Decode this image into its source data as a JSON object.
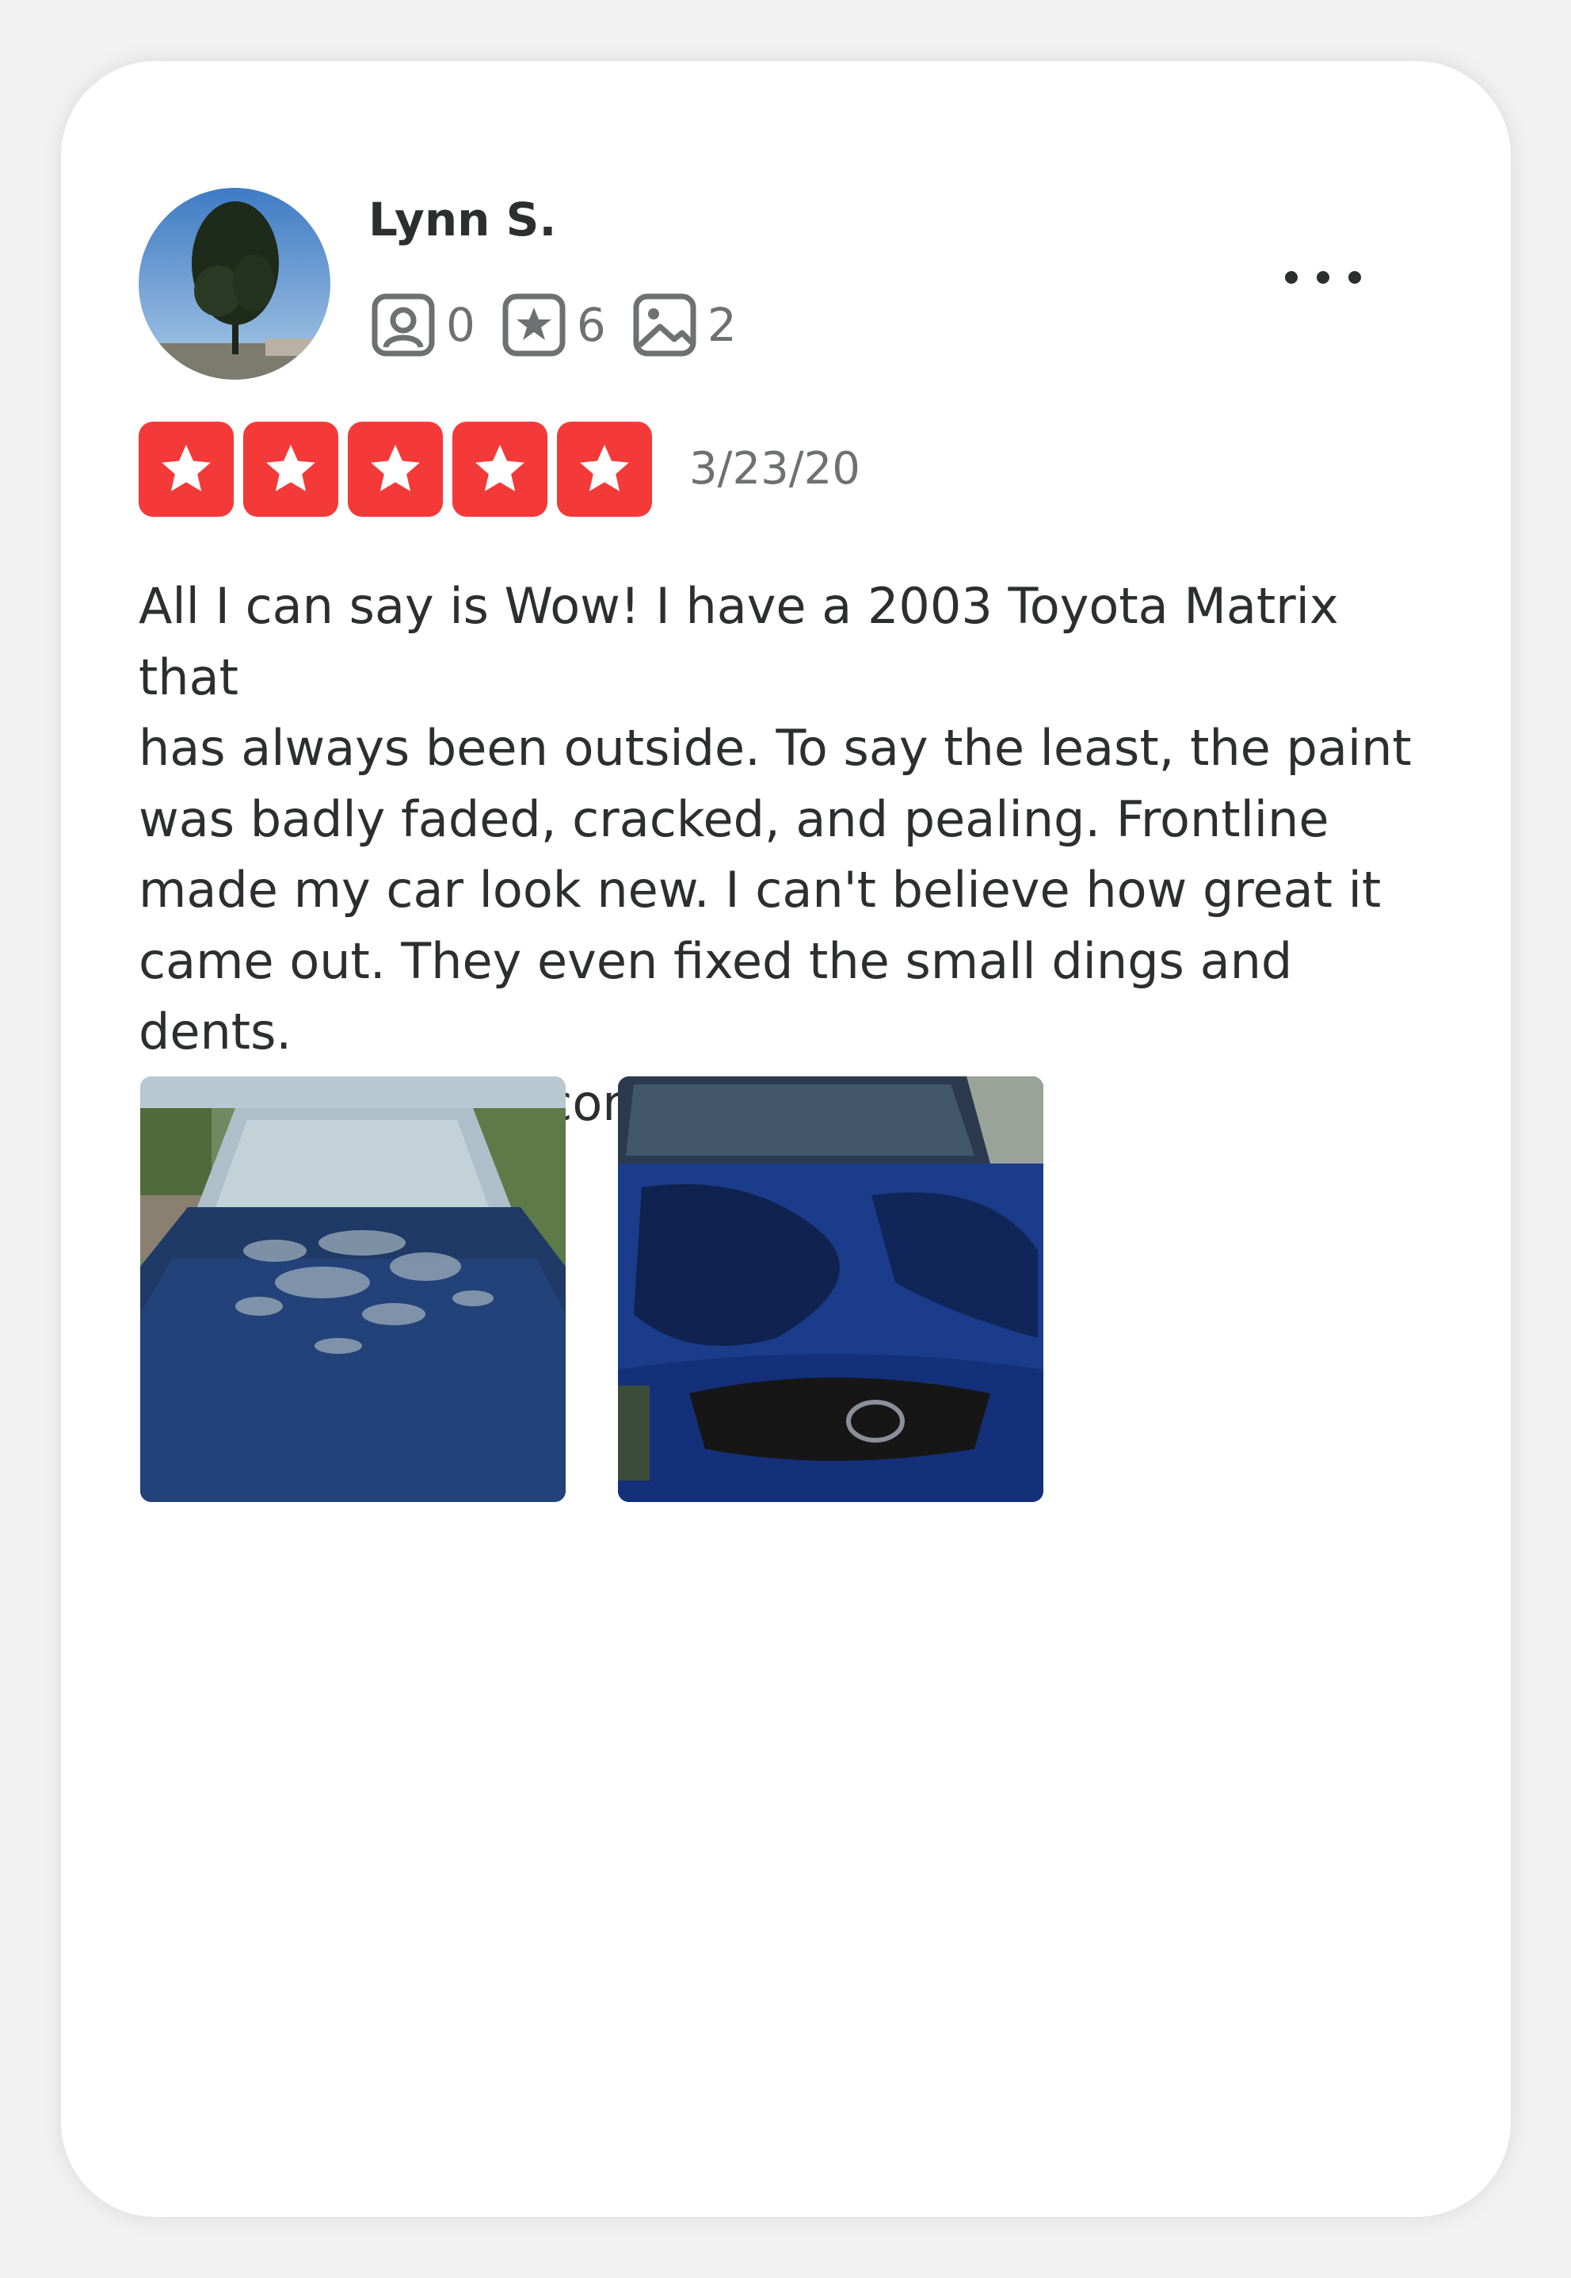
{
  "review": {
    "author": "Lynn S.",
    "stats": [
      {
        "icon": "friends-icon",
        "value": "0"
      },
      {
        "icon": "star-review-icon",
        "value": "6"
      },
      {
        "icon": "photos-icon",
        "value": "2"
      }
    ],
    "rating": 5,
    "date": "3/23/20",
    "text": "All I can say is Wow! I have a 2003 Toyota Matrix that\nhas always been outside. To say the least, the paint\nwas badly faded, cracked, and pealing. Frontline\nmade my car look new. I can't believe how great it\ncame out. They even fixed the small dings and dents.\nI would highly recommend.",
    "photos": [
      {
        "name": "photo-before-faded-hood"
      },
      {
        "name": "photo-after-repainted-hood"
      }
    ]
  },
  "colors": {
    "star_red": "#f43939",
    "text_primary": "#2d2e2f",
    "text_secondary": "#6e7072"
  }
}
